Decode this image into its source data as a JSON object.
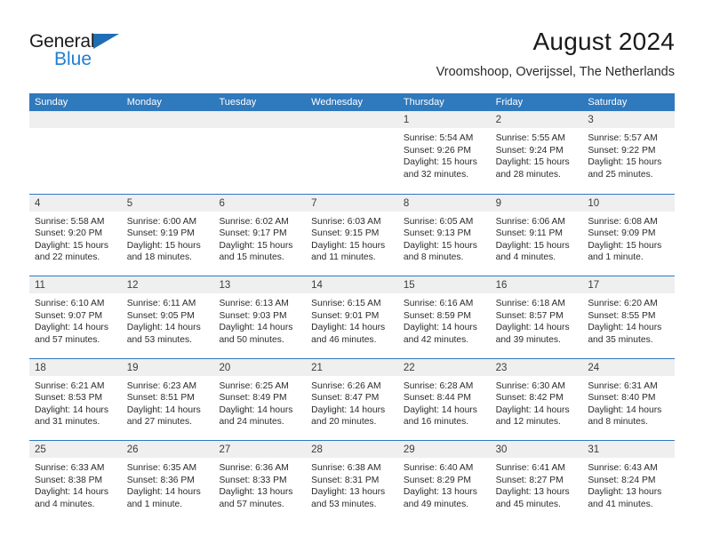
{
  "brand": {
    "name_top": "General",
    "name_bottom": "Blue",
    "accent_dark": "#1f6eb5",
    "accent_light": "#1f7fd0"
  },
  "header": {
    "title": "August 2024",
    "subtitle": "Vroomshoop, Overijssel, The Netherlands"
  },
  "theme": {
    "header_blue": "#2f79bd",
    "date_band": "#efefef",
    "text": "#2b2b2b"
  },
  "weekdays": [
    "Sunday",
    "Monday",
    "Tuesday",
    "Wednesday",
    "Thursday",
    "Friday",
    "Saturday"
  ],
  "weeks": [
    [
      {
        "day": "",
        "lines": []
      },
      {
        "day": "",
        "lines": []
      },
      {
        "day": "",
        "lines": []
      },
      {
        "day": "",
        "lines": []
      },
      {
        "day": "1",
        "lines": [
          "Sunrise: 5:54 AM",
          "Sunset: 9:26 PM",
          "Daylight: 15 hours",
          "and 32 minutes."
        ]
      },
      {
        "day": "2",
        "lines": [
          "Sunrise: 5:55 AM",
          "Sunset: 9:24 PM",
          "Daylight: 15 hours",
          "and 28 minutes."
        ]
      },
      {
        "day": "3",
        "lines": [
          "Sunrise: 5:57 AM",
          "Sunset: 9:22 PM",
          "Daylight: 15 hours",
          "and 25 minutes."
        ]
      }
    ],
    [
      {
        "day": "4",
        "lines": [
          "Sunrise: 5:58 AM",
          "Sunset: 9:20 PM",
          "Daylight: 15 hours",
          "and 22 minutes."
        ]
      },
      {
        "day": "5",
        "lines": [
          "Sunrise: 6:00 AM",
          "Sunset: 9:19 PM",
          "Daylight: 15 hours",
          "and 18 minutes."
        ]
      },
      {
        "day": "6",
        "lines": [
          "Sunrise: 6:02 AM",
          "Sunset: 9:17 PM",
          "Daylight: 15 hours",
          "and 15 minutes."
        ]
      },
      {
        "day": "7",
        "lines": [
          "Sunrise: 6:03 AM",
          "Sunset: 9:15 PM",
          "Daylight: 15 hours",
          "and 11 minutes."
        ]
      },
      {
        "day": "8",
        "lines": [
          "Sunrise: 6:05 AM",
          "Sunset: 9:13 PM",
          "Daylight: 15 hours",
          "and 8 minutes."
        ]
      },
      {
        "day": "9",
        "lines": [
          "Sunrise: 6:06 AM",
          "Sunset: 9:11 PM",
          "Daylight: 15 hours",
          "and 4 minutes."
        ]
      },
      {
        "day": "10",
        "lines": [
          "Sunrise: 6:08 AM",
          "Sunset: 9:09 PM",
          "Daylight: 15 hours",
          "and 1 minute."
        ]
      }
    ],
    [
      {
        "day": "11",
        "lines": [
          "Sunrise: 6:10 AM",
          "Sunset: 9:07 PM",
          "Daylight: 14 hours",
          "and 57 minutes."
        ]
      },
      {
        "day": "12",
        "lines": [
          "Sunrise: 6:11 AM",
          "Sunset: 9:05 PM",
          "Daylight: 14 hours",
          "and 53 minutes."
        ]
      },
      {
        "day": "13",
        "lines": [
          "Sunrise: 6:13 AM",
          "Sunset: 9:03 PM",
          "Daylight: 14 hours",
          "and 50 minutes."
        ]
      },
      {
        "day": "14",
        "lines": [
          "Sunrise: 6:15 AM",
          "Sunset: 9:01 PM",
          "Daylight: 14 hours",
          "and 46 minutes."
        ]
      },
      {
        "day": "15",
        "lines": [
          "Sunrise: 6:16 AM",
          "Sunset: 8:59 PM",
          "Daylight: 14 hours",
          "and 42 minutes."
        ]
      },
      {
        "day": "16",
        "lines": [
          "Sunrise: 6:18 AM",
          "Sunset: 8:57 PM",
          "Daylight: 14 hours",
          "and 39 minutes."
        ]
      },
      {
        "day": "17",
        "lines": [
          "Sunrise: 6:20 AM",
          "Sunset: 8:55 PM",
          "Daylight: 14 hours",
          "and 35 minutes."
        ]
      }
    ],
    [
      {
        "day": "18",
        "lines": [
          "Sunrise: 6:21 AM",
          "Sunset: 8:53 PM",
          "Daylight: 14 hours",
          "and 31 minutes."
        ]
      },
      {
        "day": "19",
        "lines": [
          "Sunrise: 6:23 AM",
          "Sunset: 8:51 PM",
          "Daylight: 14 hours",
          "and 27 minutes."
        ]
      },
      {
        "day": "20",
        "lines": [
          "Sunrise: 6:25 AM",
          "Sunset: 8:49 PM",
          "Daylight: 14 hours",
          "and 24 minutes."
        ]
      },
      {
        "day": "21",
        "lines": [
          "Sunrise: 6:26 AM",
          "Sunset: 8:47 PM",
          "Daylight: 14 hours",
          "and 20 minutes."
        ]
      },
      {
        "day": "22",
        "lines": [
          "Sunrise: 6:28 AM",
          "Sunset: 8:44 PM",
          "Daylight: 14 hours",
          "and 16 minutes."
        ]
      },
      {
        "day": "23",
        "lines": [
          "Sunrise: 6:30 AM",
          "Sunset: 8:42 PM",
          "Daylight: 14 hours",
          "and 12 minutes."
        ]
      },
      {
        "day": "24",
        "lines": [
          "Sunrise: 6:31 AM",
          "Sunset: 8:40 PM",
          "Daylight: 14 hours",
          "and 8 minutes."
        ]
      }
    ],
    [
      {
        "day": "25",
        "lines": [
          "Sunrise: 6:33 AM",
          "Sunset: 8:38 PM",
          "Daylight: 14 hours",
          "and 4 minutes."
        ]
      },
      {
        "day": "26",
        "lines": [
          "Sunrise: 6:35 AM",
          "Sunset: 8:36 PM",
          "Daylight: 14 hours",
          "and 1 minute."
        ]
      },
      {
        "day": "27",
        "lines": [
          "Sunrise: 6:36 AM",
          "Sunset: 8:33 PM",
          "Daylight: 13 hours",
          "and 57 minutes."
        ]
      },
      {
        "day": "28",
        "lines": [
          "Sunrise: 6:38 AM",
          "Sunset: 8:31 PM",
          "Daylight: 13 hours",
          "and 53 minutes."
        ]
      },
      {
        "day": "29",
        "lines": [
          "Sunrise: 6:40 AM",
          "Sunset: 8:29 PM",
          "Daylight: 13 hours",
          "and 49 minutes."
        ]
      },
      {
        "day": "30",
        "lines": [
          "Sunrise: 6:41 AM",
          "Sunset: 8:27 PM",
          "Daylight: 13 hours",
          "and 45 minutes."
        ]
      },
      {
        "day": "31",
        "lines": [
          "Sunrise: 6:43 AM",
          "Sunset: 8:24 PM",
          "Daylight: 13 hours",
          "and 41 minutes."
        ]
      }
    ]
  ]
}
